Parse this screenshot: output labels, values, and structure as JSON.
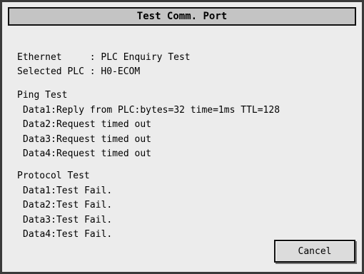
{
  "title": "Test Comm. Port",
  "info": {
    "ethernet": "Ethernet     : PLC Enquiry Test",
    "selected_plc": "Selected PLC : H0-ECOM"
  },
  "ping": {
    "heading": "Ping Test",
    "lines": [
      "Data1:Reply from PLC:bytes=32 time=1ms TTL=128",
      "Data2:Request timed out",
      "Data3:Request timed out",
      "Data4:Request timed out"
    ]
  },
  "protocol": {
    "heading": "Protocol Test",
    "lines": [
      "Data1:Test Fail.",
      "Data2:Test Fail.",
      "Data3:Test Fail.",
      "Data4:Test Fail."
    ]
  },
  "buttons": {
    "cancel": "Cancel"
  }
}
